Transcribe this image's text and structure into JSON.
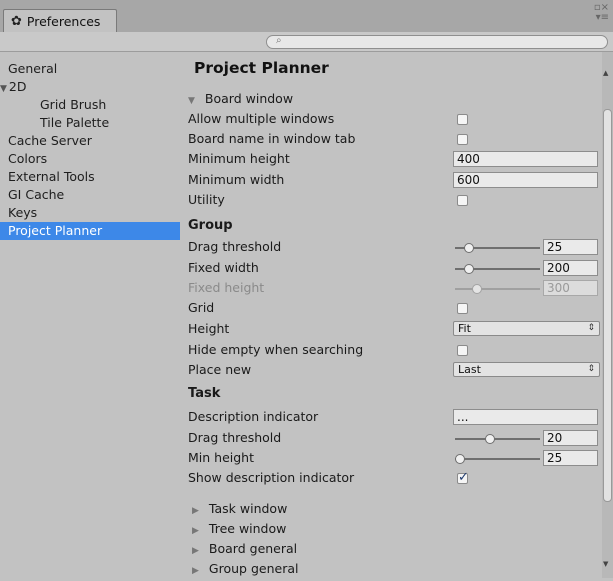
{
  "window": {
    "tab_icon": "gear-icon",
    "tab_title": "Preferences",
    "controls_glyph_1": "▫×",
    "controls_glyph_2": "▾≡"
  },
  "search": {
    "value": "",
    "placeholder": ""
  },
  "sidebar": {
    "items": [
      {
        "label": "General",
        "selected": false
      },
      {
        "label": "2D",
        "selected": false,
        "expanded": true
      },
      {
        "label": "Grid Brush",
        "selected": false
      },
      {
        "label": "Tile Palette",
        "selected": false
      },
      {
        "label": "Cache Server",
        "selected": false
      },
      {
        "label": "Colors",
        "selected": false
      },
      {
        "label": "External Tools",
        "selected": false
      },
      {
        "label": "GI Cache",
        "selected": false
      },
      {
        "label": "Keys",
        "selected": false
      },
      {
        "label": "Project Planner",
        "selected": true
      }
    ],
    "selected_color": "#3d88e8"
  },
  "main": {
    "title": "Project Planner",
    "board_window": {
      "label": "Board window",
      "expanded": true,
      "allow_multiple_windows": {
        "label": "Allow multiple windows",
        "checked": false
      },
      "board_name_in_tab": {
        "label": "Board name in window tab",
        "checked": false
      },
      "minimum_height": {
        "label": "Minimum height",
        "value": "400"
      },
      "minimum_width": {
        "label": "Minimum width",
        "value": "600"
      },
      "utility": {
        "label": "Utility",
        "checked": false
      }
    },
    "group": {
      "title": "Group",
      "drag_threshold": {
        "label": "Drag threshold",
        "value": "25",
        "level": 0.25
      },
      "fixed_width": {
        "label": "Fixed width",
        "value": "200",
        "level": 0.25
      },
      "fixed_height": {
        "label": "Fixed height",
        "value": "300",
        "level": 0.3,
        "disabled": true
      },
      "grid": {
        "label": "Grid",
        "checked": false
      },
      "height": {
        "label": "Height",
        "value": "Fit"
      },
      "hide_empty": {
        "label": "Hide empty when searching",
        "checked": false
      },
      "place_new": {
        "label": "Place new",
        "value": "Last"
      }
    },
    "task": {
      "title": "Task",
      "description_indicator": {
        "label": "Description indicator",
        "value": "..."
      },
      "drag_threshold": {
        "label": "Drag threshold",
        "value": "20",
        "level": 0.35
      },
      "min_height": {
        "label": "Min height",
        "value": "25",
        "level": 0.0
      },
      "show_description_indicator": {
        "label": "Show description indicator",
        "checked": true
      }
    },
    "collapsed_sections": [
      "Task window",
      "Tree window",
      "Board general",
      "Group general"
    ]
  }
}
